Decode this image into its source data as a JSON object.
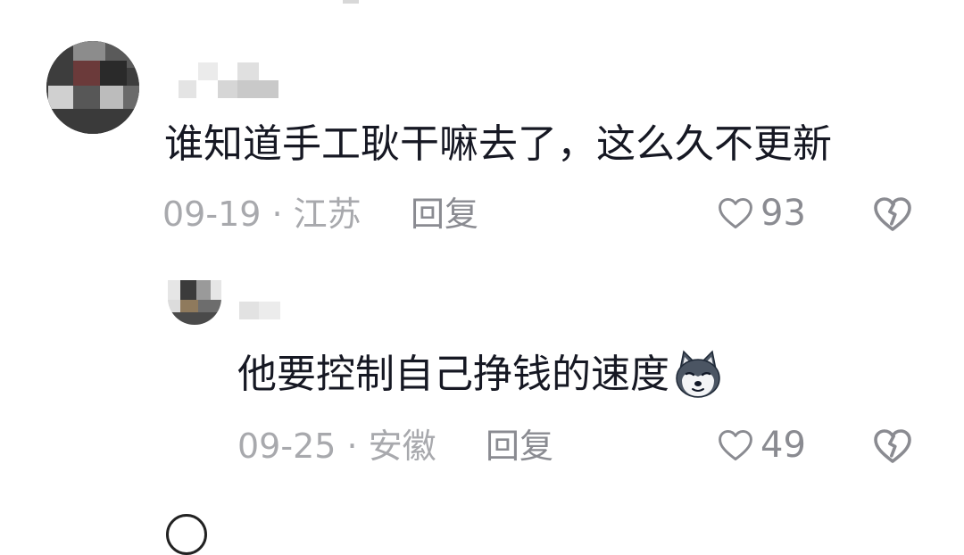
{
  "comments": [
    {
      "username": "",
      "text": "谁知道手工耿干嘛去了，这么久不更新",
      "date_location": "09-19 · 江苏",
      "reply_label": "回复",
      "like_count": "93",
      "icons": {
        "like": "heart-outline-icon",
        "dislike": "broken-heart-icon"
      }
    }
  ],
  "replies": [
    {
      "username": "",
      "text": "他要控制自己挣钱的速度",
      "emoji": "dog-face-emoji",
      "date_location": "09-25 · 安徽",
      "reply_label": "回复",
      "like_count": "49",
      "icons": {
        "like": "heart-outline-icon",
        "dislike": "broken-heart-icon"
      }
    }
  ],
  "colors": {
    "text_primary": "#161823",
    "text_secondary": "#a8a9ad",
    "icon_gray": "#8a8b91",
    "background": "#ffffff"
  }
}
